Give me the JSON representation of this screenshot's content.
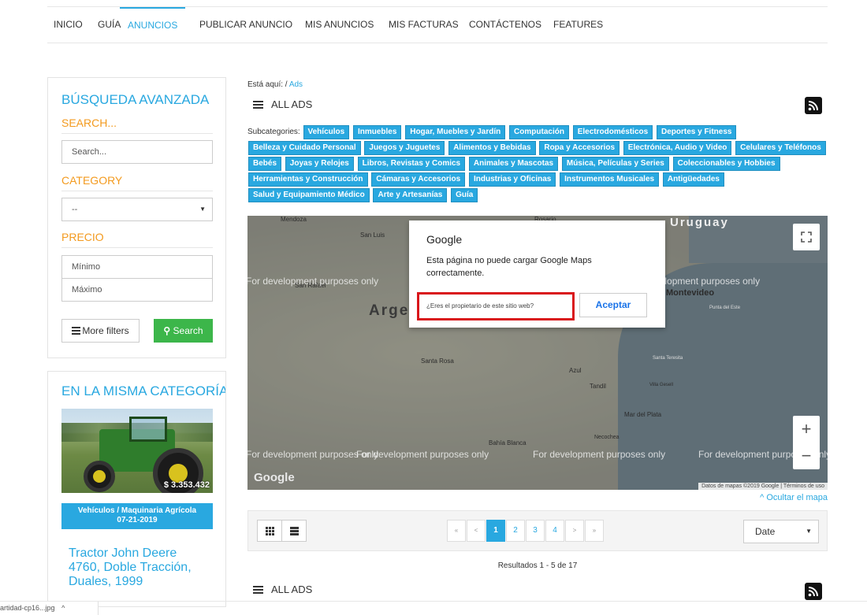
{
  "nav": {
    "items": [
      "INICIO",
      "GUÍA",
      "ANUNCIOS",
      "PUBLICAR ANUNCIO",
      "MIS ANUNCIOS",
      "MIS FACTURAS",
      "CONTÁCTENOS",
      "FEATURES"
    ],
    "active": "ANUNCIOS"
  },
  "sidebar": {
    "search_box": {
      "title": "BÚSQUEDA AVANZADA",
      "search_label": "SEARCH...",
      "search_placeholder": "Search...",
      "category_label": "CATEGORY",
      "category_value": "--",
      "price_label": "PRECIO",
      "min_placeholder": "Mínimo",
      "max_placeholder": "Máximo",
      "more_filters": "More filters",
      "search_button": "Search"
    },
    "same_category": {
      "title": "EN LA MISMA CATEGORÍA",
      "price": "$ 3.353.432",
      "category": "Vehículos / Maquinaria Agrícola",
      "date": "07-21-2019",
      "ad_title": "Tractor John Deere 4760, Doble Tracción, Duales, 1999"
    }
  },
  "main": {
    "breadcrumb_prefix": "Está aquí: /",
    "breadcrumb_link": "Ads",
    "heading": "ALL ADS",
    "subcategories_label": "Subcategories:",
    "subcategories": [
      "Vehículos",
      "Inmuebles",
      "Hogar, Muebles y Jardín",
      "Computación",
      "Electrodomésticos",
      "Deportes y Fitness",
      "Belleza y Cuidado Personal",
      "Juegos y Juguetes",
      "Alimentos y Bebidas",
      "Ropa y Accesorios",
      "Electrónica, Audio y Video",
      "Celulares y Teléfonos",
      "Bebés",
      "Joyas y Relojes",
      "Libros, Revistas y Comics",
      "Animales y Mascotas",
      "Música, Películas y Series",
      "Coleccionables y Hobbies",
      "Herramientas y Construcción",
      "Cámaras y Accesorios",
      "Industrias y Oficinas",
      "Instrumentos Musicales",
      "Antigüedades",
      "Salud y Equipamiento Médico",
      "Arte y Artesanías",
      "Guía"
    ],
    "map": {
      "labels": [
        "Mendoza",
        "San Luis",
        "San Rafael",
        "Rosario",
        "Montevideo",
        "Punta del Este",
        "Santa Rosa",
        "Azul",
        "Tandil",
        "Villa Gesell",
        "Santa Teresita",
        "Mar del Plata",
        "Necochea",
        "Bahía Blanca"
      ],
      "country_big_left": "Arge",
      "country_big_right": "Uruguay",
      "dev_text": "For development purposes only",
      "google_logo": "Google",
      "attribution": "Datos de mapas ©2019 Google | Términos de uso",
      "dialog": {
        "title": "Google",
        "message": "Esta página no puede cargar Google Maps correctamente.",
        "owner_link": "¿Eres el propietario de este sitio web?",
        "accept": "Aceptar"
      }
    },
    "hide_map": "Ocultar el mapa",
    "pagination": [
      "«",
      "<",
      "1",
      "2",
      "3",
      "4",
      ">",
      "»"
    ],
    "current_page": "1",
    "sort_value": "Date",
    "results": "Resultados 1 - 5 de 17",
    "heading_bottom": "ALL ADS"
  },
  "download_bar": {
    "file": "artidad-cp16...jpg"
  }
}
